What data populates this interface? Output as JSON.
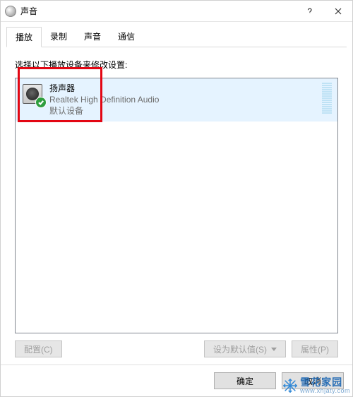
{
  "title": "声音",
  "tabs": [
    "播放",
    "录制",
    "声音",
    "通信"
  ],
  "activeTab": 0,
  "instruction": "选择以下播放设备来修改设置:",
  "device": {
    "name": "扬声器",
    "desc": "Realtek High Definition Audio",
    "status": "默认设备"
  },
  "buttons": {
    "configure": "配置(C)",
    "set_default": "设为默认值(S)",
    "properties": "属性(P)",
    "ok": "确定",
    "cancel": "取消"
  },
  "watermark": {
    "main": "雪花家园",
    "sub": "www.xhjaty.com"
  }
}
